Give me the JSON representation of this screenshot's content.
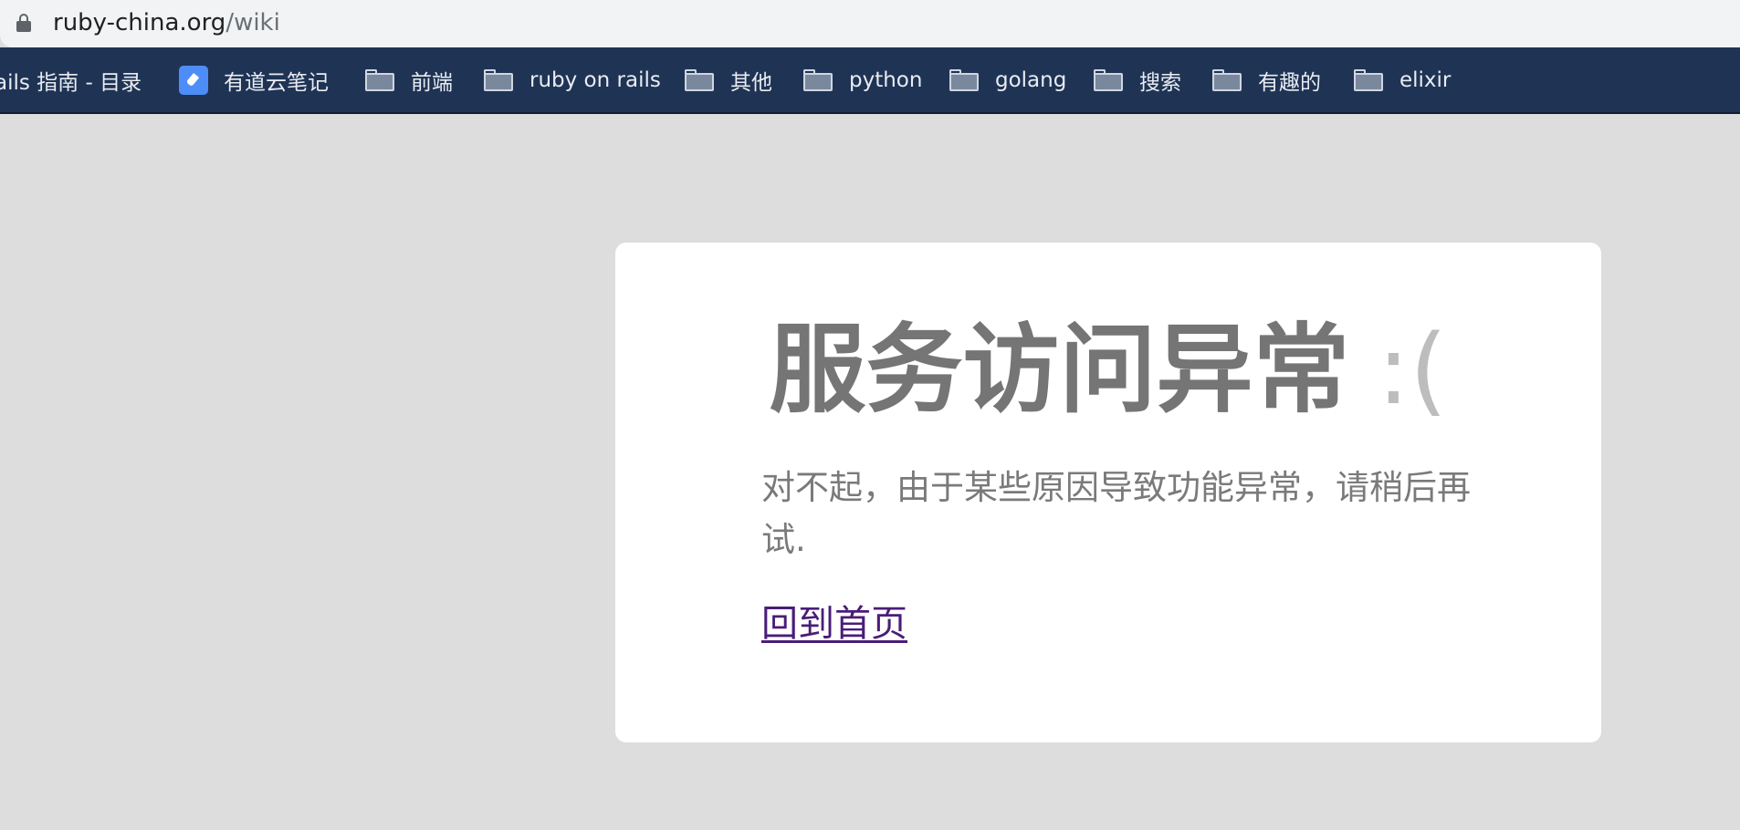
{
  "address_bar": {
    "host": "ruby-china.org",
    "path": "/wiki"
  },
  "bookmarks": [
    {
      "label": "ails 指南 - 目录",
      "icon": "none"
    },
    {
      "label": "有道云笔记",
      "icon": "youdao-note-icon"
    },
    {
      "label": "前端",
      "icon": "folder-icon"
    },
    {
      "label": "ruby on rails",
      "icon": "folder-icon"
    },
    {
      "label": "其他",
      "icon": "folder-icon"
    },
    {
      "label": "python",
      "icon": "folder-icon"
    },
    {
      "label": "golang",
      "icon": "folder-icon"
    },
    {
      "label": "搜索",
      "icon": "folder-icon"
    },
    {
      "label": "有趣的",
      "icon": "folder-icon"
    },
    {
      "label": "elixir",
      "icon": "folder-icon"
    }
  ],
  "error_card": {
    "title": "服务访问异常",
    "face": ":(",
    "message": "对不起，由于某些原因导致功能异常，请稍后再试.",
    "home_link": "回到首页"
  },
  "colors": {
    "page_background": "#dddddd",
    "bookmarks_bar": "#1f3354",
    "title_text": "#757575",
    "link": "#4a1d78"
  }
}
